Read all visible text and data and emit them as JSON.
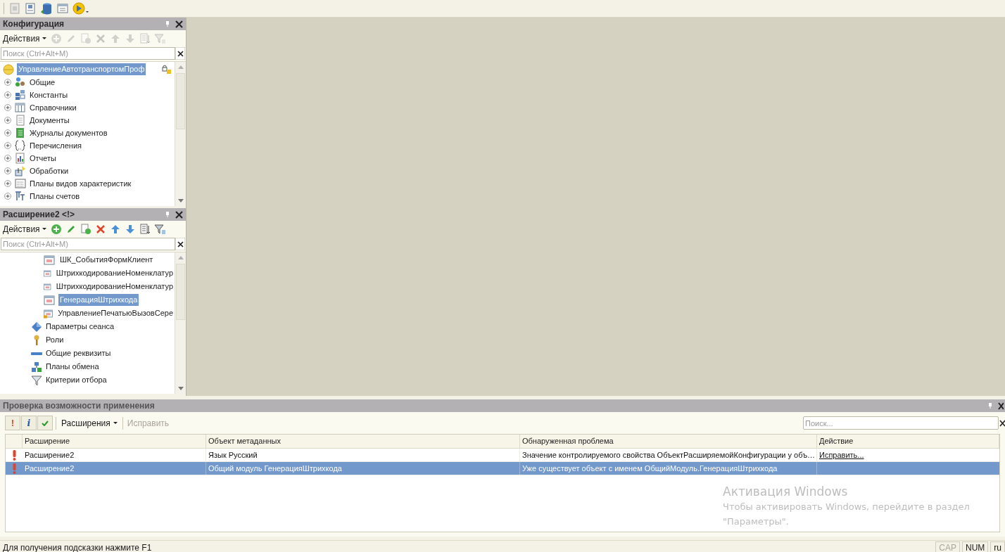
{
  "config_panel": {
    "title": "Конфигурация",
    "actions_label": "Действия",
    "actions_enabled": false,
    "search": {
      "placeholder": "Поиск (Ctrl+Alt+M)"
    },
    "tree": {
      "root": {
        "label": "УправлениеАвтотранспортомПроф",
        "selected": true
      },
      "items": [
        {
          "label": "Общие",
          "expanded": false
        },
        {
          "label": "Константы",
          "expanded": false
        },
        {
          "label": "Справочники",
          "expanded": false
        },
        {
          "label": "Документы",
          "expanded": false
        },
        {
          "label": "Журналы документов",
          "expanded": false
        },
        {
          "label": "Перечисления",
          "expanded": false
        },
        {
          "label": "Отчеты",
          "expanded": false
        },
        {
          "label": "Обработки",
          "expanded": false
        },
        {
          "label": "Планы видов характеристик",
          "expanded": false
        },
        {
          "label": "Планы счетов",
          "expanded": false
        }
      ]
    }
  },
  "extension_panel": {
    "title": "Расширение2 <!>",
    "actions_label": "Действия",
    "actions_enabled": true,
    "search": {
      "placeholder": "Поиск (Ctrl+Alt+M)"
    },
    "tree": {
      "nested_items": [
        {
          "label": "ШК_СобытияФормКлиент",
          "selected": false
        },
        {
          "label": "ШтрихкодированиеНоменклатур",
          "selected": false
        },
        {
          "label": "ШтрихкодированиеНоменклатур",
          "selected": false
        },
        {
          "label": "ГенерацияШтрихкода",
          "selected": true
        },
        {
          "label": "УправлениеПечатьюВызовСере",
          "selected": false
        }
      ],
      "items": [
        {
          "label": "Параметры сеанса"
        },
        {
          "label": "Роли"
        },
        {
          "label": "Общие реквизиты"
        },
        {
          "label": "Планы обмена"
        },
        {
          "label": "Критерии отбора"
        }
      ]
    }
  },
  "check_panel": {
    "title": "Проверка возможности применения",
    "filters": [
      {
        "kind": "error",
        "glyph": "!"
      },
      {
        "kind": "info",
        "glyph": "i"
      },
      {
        "kind": "ok"
      }
    ],
    "extensions_menu": "Расширения",
    "fix_button": {
      "label": "Исправить",
      "disabled": true
    },
    "search": {
      "placeholder": "Поиск..."
    },
    "table": {
      "columns": [
        "Расширение",
        "Объект метаданных",
        "Обнаруженная проблема",
        "Действие"
      ],
      "rows": [
        {
          "kind": "error",
          "selected": false,
          "cells": [
            "Расширение2",
            "Язык Русский",
            "Значение контролируемого свойства ОбъектРасширяемойКонфигурации у объ…"
          ],
          "action": "Исправить..."
        },
        {
          "kind": "error",
          "selected": true,
          "cells": [
            "Расширение2",
            "Общий модуль ГенерацияШтрихкода",
            "Уже существует объект с именем ОбщийМодуль.ГенерацияШтрихкода"
          ]
        }
      ]
    }
  },
  "activation_notice": {
    "title": "Активация Windows",
    "text": "Чтобы активировать Windows, перейдите в раздел \"Параметры\"."
  },
  "status_bar": {
    "hint": "Для получения подсказки нажмите F1",
    "indicators": [
      {
        "label": "CAP",
        "on": false
      },
      {
        "label": "NUM",
        "on": true
      },
      {
        "label": "ru",
        "on": true
      }
    ]
  }
}
